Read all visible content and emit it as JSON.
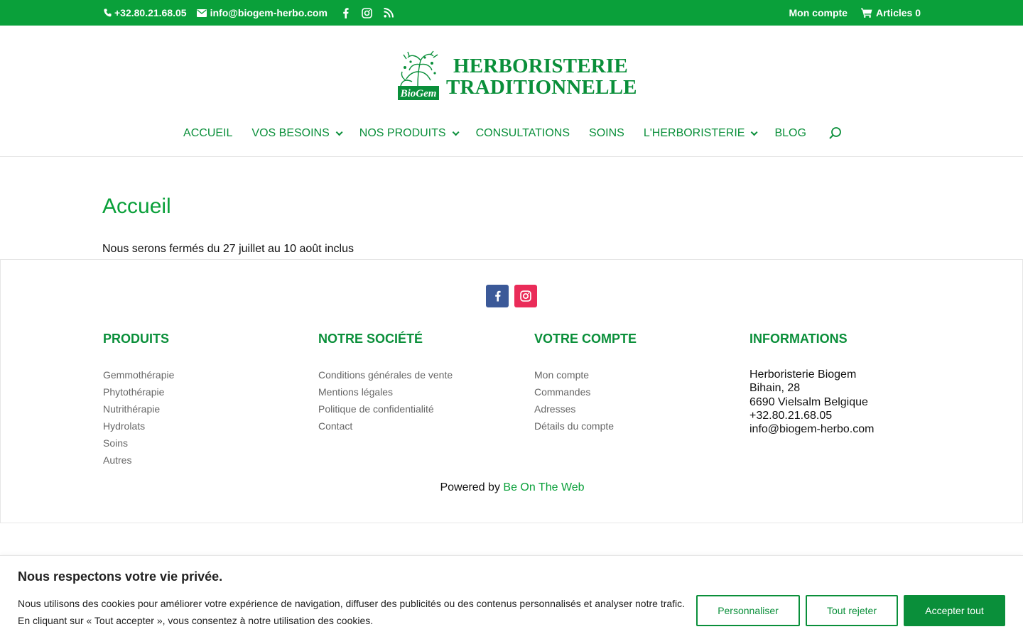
{
  "topbar": {
    "phone": "+32.80.21.68.05",
    "email": "info@biogem-herbo.com",
    "account": "Mon compte",
    "cart": "Articles 0"
  },
  "logo": {
    "line1": "HERBORISTERIE",
    "line2": "TRADITIONNELLE",
    "emblem_text": "BioGem"
  },
  "nav": {
    "items": [
      {
        "label": "ACCUEIL",
        "has_dropdown": false
      },
      {
        "label": "VOS BESOINS",
        "has_dropdown": true
      },
      {
        "label": "NOS PRODUITS",
        "has_dropdown": true
      },
      {
        "label": "CONSULTATIONS",
        "has_dropdown": false
      },
      {
        "label": "SOINS",
        "has_dropdown": false
      },
      {
        "label": "L'HERBORISTERIE",
        "has_dropdown": true
      },
      {
        "label": "BLOG",
        "has_dropdown": false
      }
    ]
  },
  "main": {
    "title": "Accueil",
    "notice": "Nous serons fermés du 27 juillet au 10 août inclus"
  },
  "footer": {
    "produits": {
      "title": "PRODUITS",
      "links": [
        "Gemmothérapie",
        "Phytothérapie",
        "Nutrithérapie",
        "Hydrolats",
        "Soins",
        "Autres"
      ]
    },
    "societe": {
      "title": "NOTRE SOCIÉTÉ",
      "links": [
        "Conditions générales de vente",
        "Mentions légales",
        "Politique de confidentialité",
        "Contact"
      ]
    },
    "compte": {
      "title": "VOTRE COMPTE",
      "links": [
        "Mon compte",
        "Commandes",
        "Adresses",
        "Détails du compte"
      ]
    },
    "informations": {
      "title": "INFORMATIONS",
      "lines": [
        "Herboristerie Biogem",
        "Bihain, 28",
        "6690 Vielsalm Belgique",
        "+32.80.21.68.05",
        "info@biogem-herbo.com"
      ]
    },
    "powered_prefix": "Powered by",
    "powered_link": "Be On The Web"
  },
  "cookie": {
    "title": "Nous respectons votre vie privée.",
    "line1": "Nous utilisons des cookies pour améliorer votre expérience de navigation, diffuser des publicités ou des contenus personnalisés et analyser notre trafic.",
    "line2": "En cliquant sur « Tout accepter », vous consentez à notre utilisation des cookies.",
    "personalize": "Personnaliser",
    "reject": "Tout rejeter",
    "accept": "Accepter tout"
  },
  "colors": {
    "brand_green": "#0aa03a",
    "dark_green": "#0a8f3a",
    "facebook": "#3b5998",
    "instagram": "#ea2c59"
  }
}
